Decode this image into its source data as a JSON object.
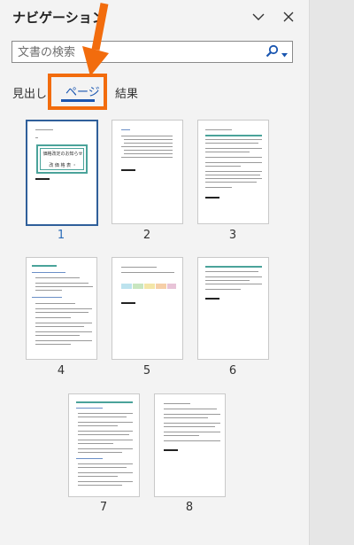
{
  "pane": {
    "title": "ナビゲーション",
    "search_placeholder": "文書の検索",
    "tabs": [
      "見出し",
      "ページ",
      "結果"
    ],
    "selected_tab": "ページ",
    "selected_page": "1",
    "page_numbers": [
      "1",
      "2",
      "3",
      "4",
      "5",
      "6",
      "7",
      "8"
    ]
  },
  "thumbnail_text": {
    "cover_title": "価格改定のお知らせ",
    "cover_subtitle": "改 価 格 表 ・"
  },
  "colors": {
    "accent": "#1a56b0",
    "highlight": "#f26c0d",
    "selected_border": "#2f5f9a",
    "teal": "#4aa39a"
  },
  "icons": {
    "collapse": "chevron-down-icon",
    "close": "close-icon",
    "search": "search-icon",
    "search_options": "caret-down-icon",
    "annotation": "orange-arrow"
  }
}
